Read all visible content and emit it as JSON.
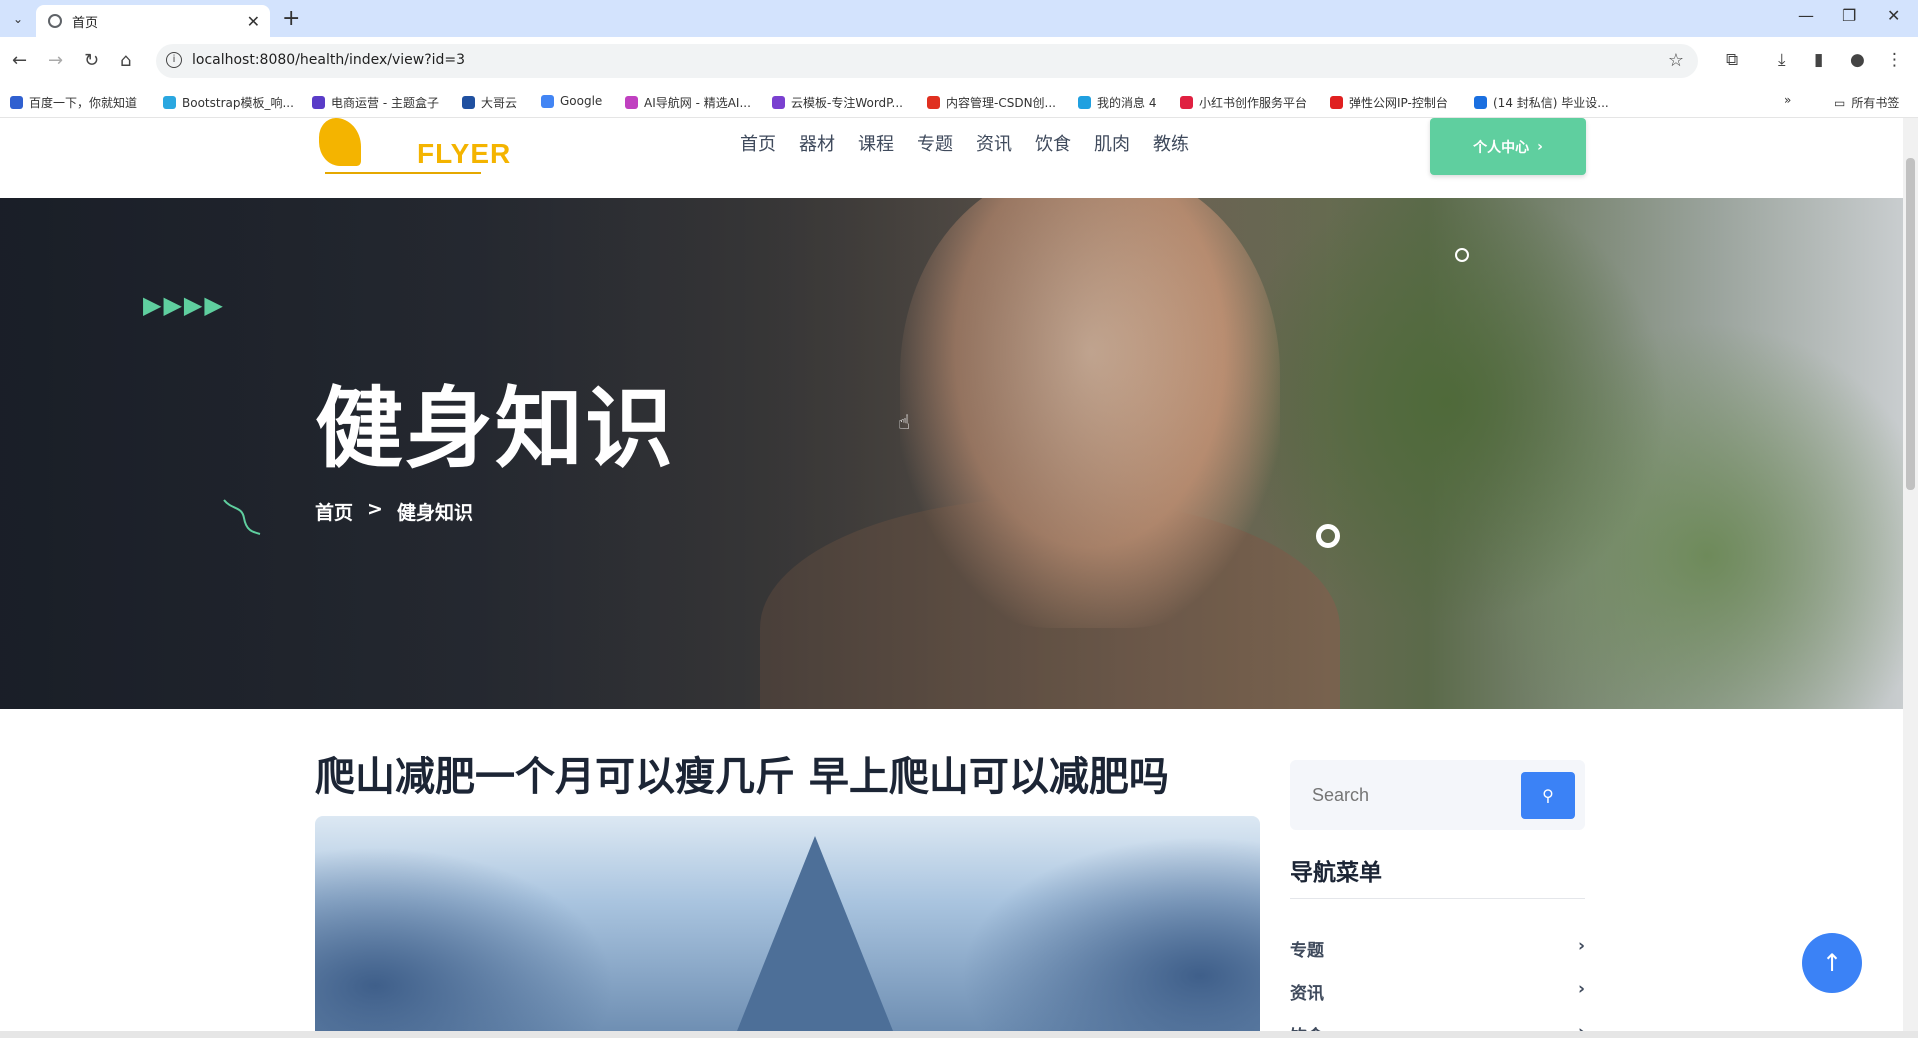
{
  "browser": {
    "tab_title": "首页",
    "url": "localhost:8080/health/index/view?id=3",
    "bookmarks": [
      {
        "label": "百度一下，你就知道",
        "color": "#3060d0"
      },
      {
        "label": "Bootstrap模板_响...",
        "color": "#2aa7e0"
      },
      {
        "label": "电商运营 - 主题盒子",
        "color": "#5a3cc8"
      },
      {
        "label": "大哥云",
        "color": "#2050a0"
      },
      {
        "label": "Google",
        "color": "#4285f4"
      },
      {
        "label": "AI导航网 - 精选AI...",
        "color": "#c040c0"
      },
      {
        "label": "云模板-专注WordP...",
        "color": "#7a40d0"
      },
      {
        "label": "内容管理-CSDN创...",
        "color": "#e03020"
      },
      {
        "label": "我的消息 4",
        "color": "#20a0e0"
      },
      {
        "label": "小红书创作服务平台",
        "color": "#e02040"
      },
      {
        "label": "弹性公网IP-控制台",
        "color": "#e02020"
      },
      {
        "label": "(14 封私信) 毕业设...",
        "color": "#1a6fe0"
      }
    ],
    "all_bookmarks": "所有书签"
  },
  "site": {
    "logo_text": "FLYER",
    "nav": [
      "首页",
      "器材",
      "课程",
      "专题",
      "资讯",
      "饮食",
      "肌肉",
      "教练"
    ],
    "user_center": "个人中心"
  },
  "hero": {
    "decor_arrows": "▶▶▶▶",
    "title": "健身知识",
    "breadcrumb_home": "首页",
    "breadcrumb_sep": ">",
    "breadcrumb_current": "健身知识"
  },
  "article": {
    "title": "爬山减肥一个月可以瘦几斤 早上爬山可以减肥吗"
  },
  "sidebar": {
    "search_placeholder": "Search",
    "heading": "导航菜单",
    "items": [
      "专题",
      "资讯",
      "饮食"
    ]
  },
  "colors": {
    "accent_green": "#5fcf9f",
    "accent_blue": "#3b82f6",
    "logo_yellow": "#f4b400"
  }
}
